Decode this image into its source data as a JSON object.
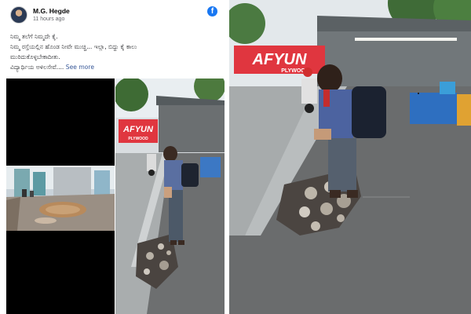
{
  "post": {
    "author": "M.G. Hegde",
    "time": "11 hours ago",
    "lines": [
      "ನಿಮ್ಮ ತಲೆಗೆ ನಿಮ್ಮದೇ ಕೈ.",
      "ನಿಮ್ಮ ರಸ್ತೆಯಲ್ಲಿನ ಹೊಂಡ ನೀವೇ ಮುಚ್ಚಿ... ಇಲ್ಲಾ, ಬಿದ್ದು ಕೈ ಕಾಲು",
      "ಮುರಿದುಕೊಳ್ಳಬೇಕಾದೀತು.",
      "ವಿದ್ಯಾರ್ಥಿಯ ಅಳಿಲಸೇವೆ...."
    ],
    "see_more": "See more"
  },
  "signage": {
    "brand": "AFYUN",
    "sub": "PLYWOOD"
  },
  "colors": {
    "facebook_blue": "#1877f2",
    "sign_red": "#e0363f",
    "link": "#385898"
  },
  "icons": {
    "facebook": "facebook-logo-icon"
  }
}
